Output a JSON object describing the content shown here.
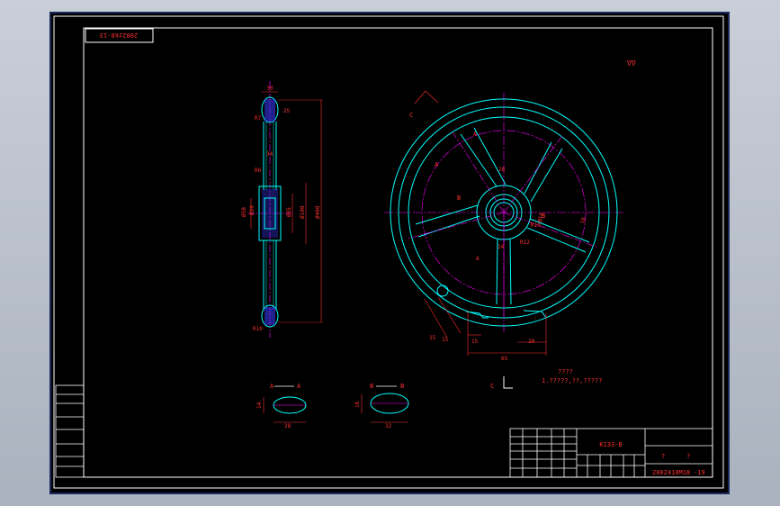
{
  "colors": {
    "background": "#000000",
    "outline": "#00ffff",
    "center_line": "#ff00ff",
    "dimension": "#ff2020",
    "frame": "#ffffff",
    "hatch_blue": "#3a3aff"
  },
  "drawing": {
    "stamp_code": "2002zk8-13",
    "part_code": "K133-B",
    "drawing_no": "2002410M18",
    "drawing_no_suffix": "-19",
    "tech_title": "????",
    "tech_note": "1.?????,??,?????",
    "roughness_mark": "∇∇",
    "title_block_q1": "?",
    "title_block_q2": "?"
  },
  "side_view": {
    "dims": [
      "30",
      "25",
      "R7",
      "34",
      "R6",
      "Ø50",
      "Ø20",
      "Ø85",
      "Ø100",
      "Ø400",
      "R10"
    ]
  },
  "front_view": {
    "dims": [
      "15",
      "15",
      "15",
      "20",
      "65",
      "18",
      "R12",
      "R10",
      "Ø16",
      "24",
      "28",
      "A"
    ],
    "section_markers": [
      "A",
      "A",
      "B",
      "B",
      "C",
      "C"
    ]
  },
  "sections": {
    "a": {
      "label": "A",
      "width": "28",
      "height": "14"
    },
    "b": {
      "label": "B",
      "width": "32",
      "height": "16"
    }
  }
}
